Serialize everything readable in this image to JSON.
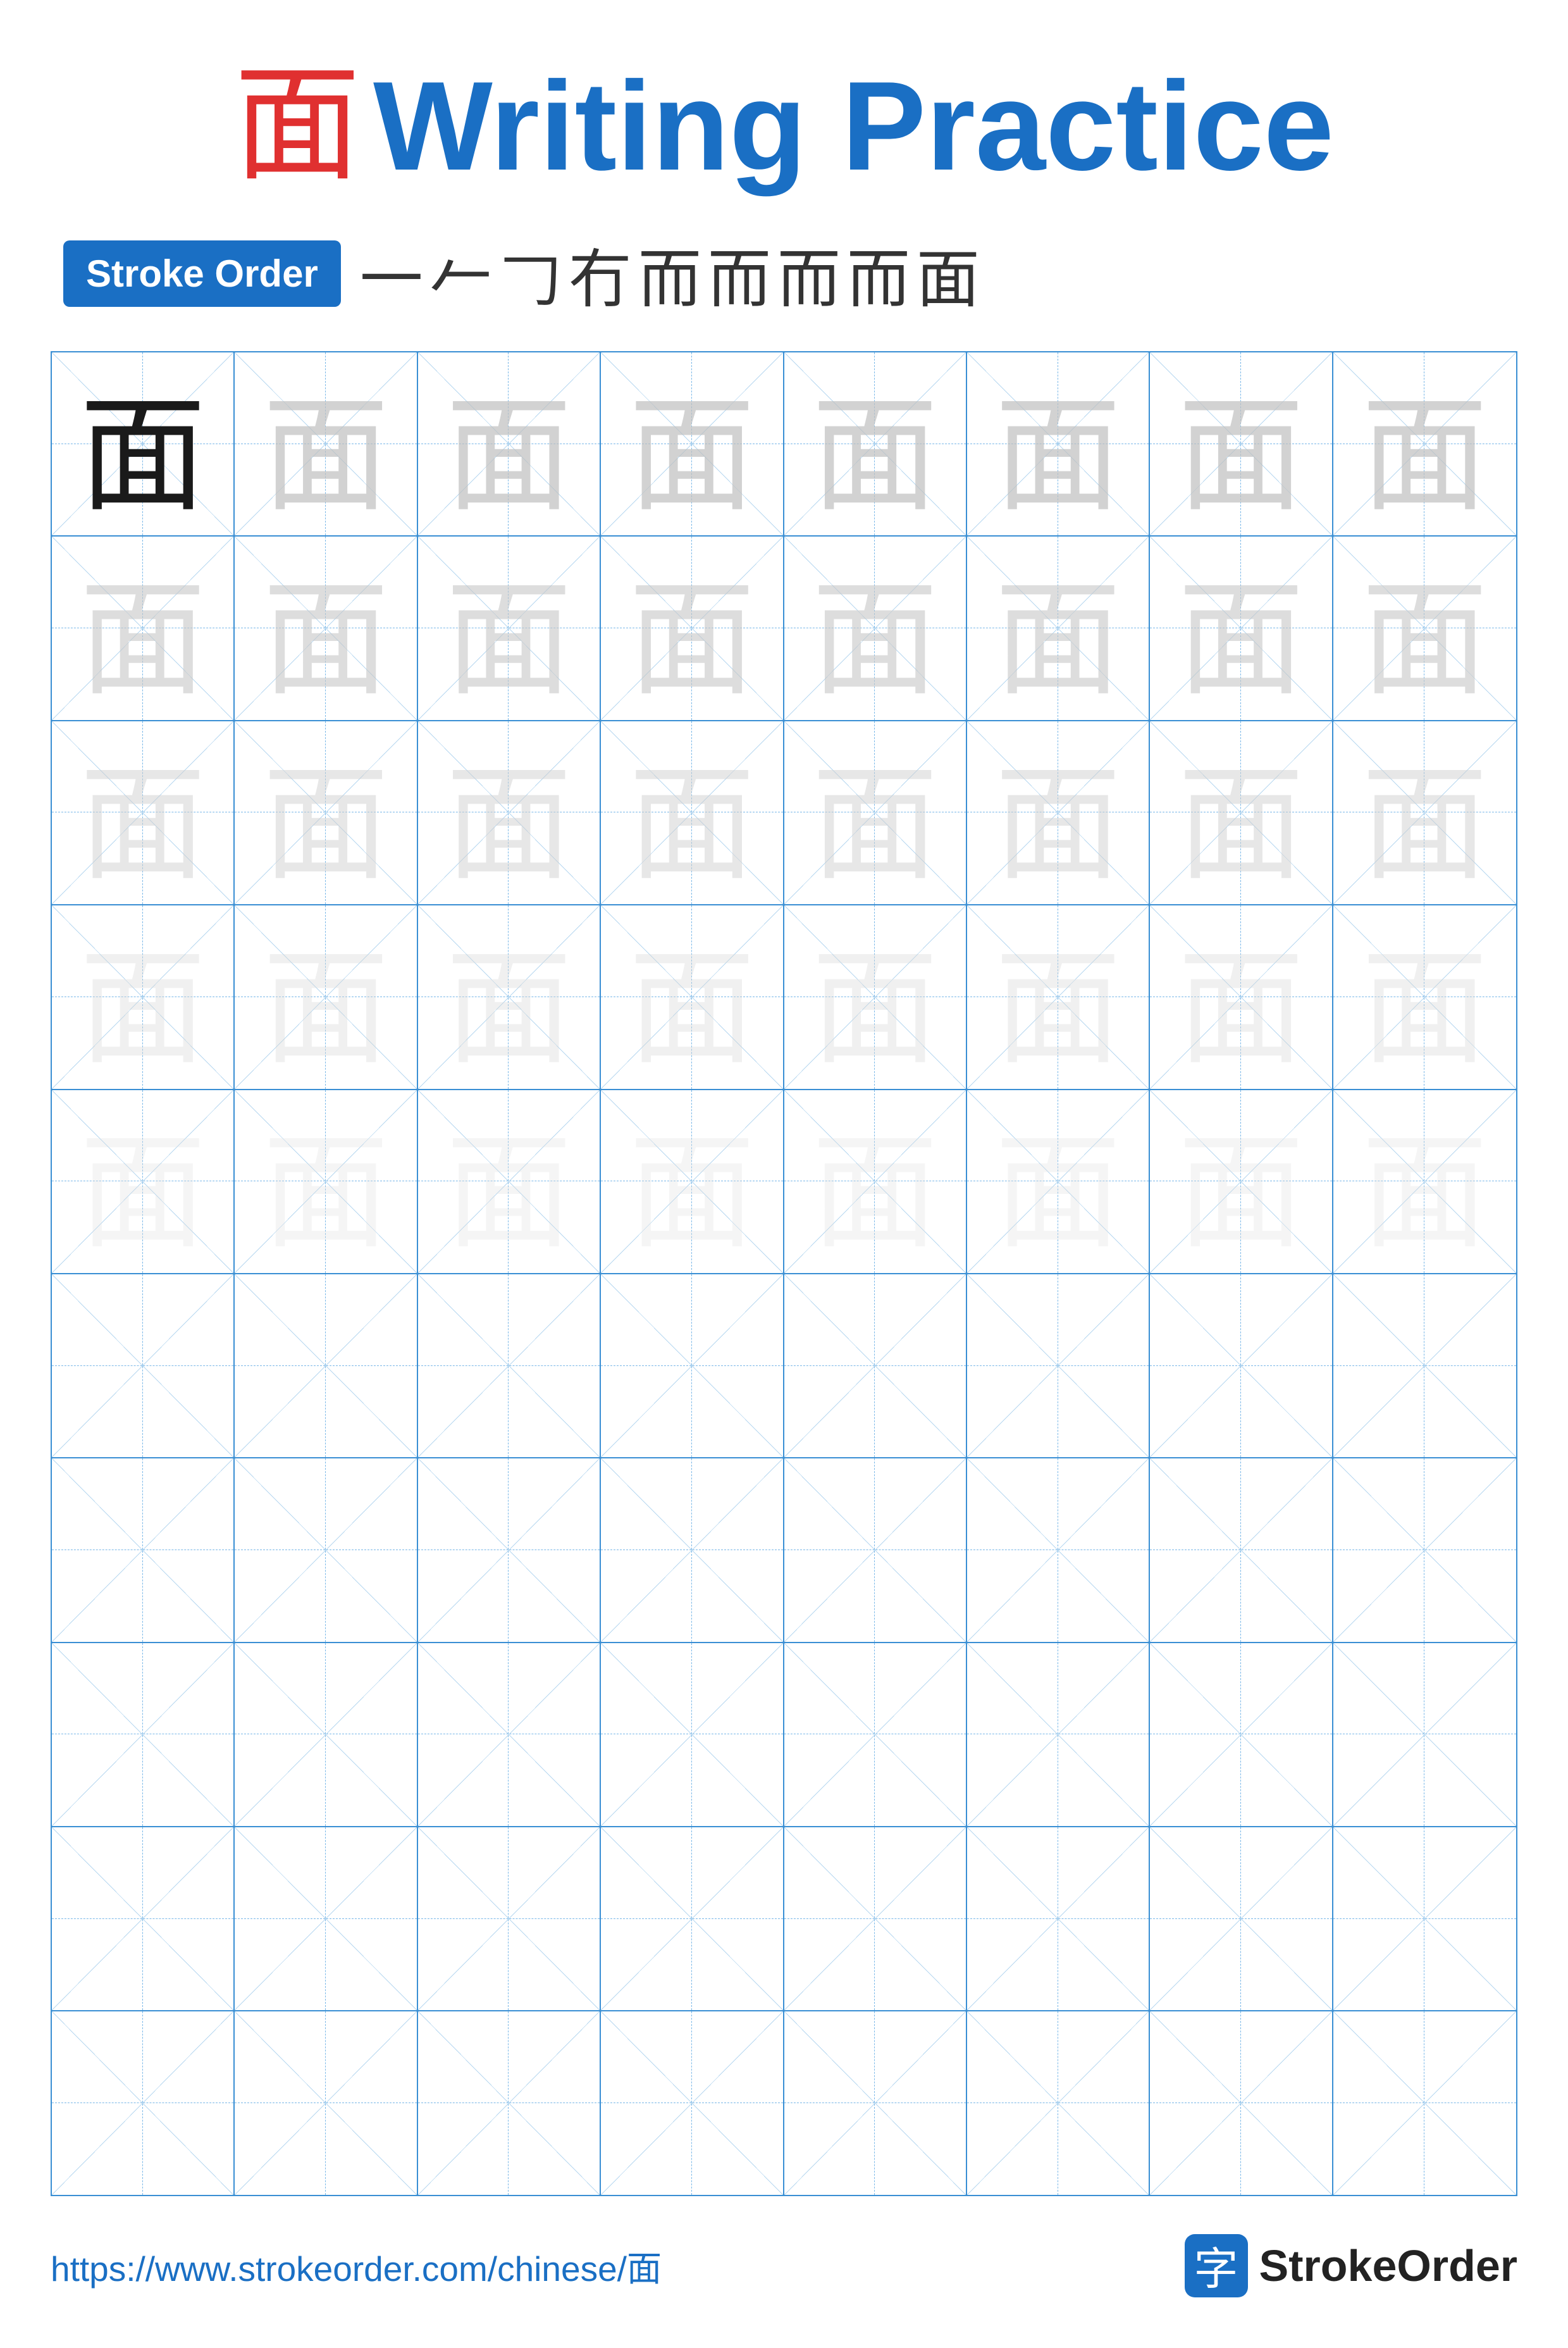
{
  "title": {
    "char": "面",
    "text": "Writing Practice"
  },
  "strokeOrder": {
    "badge": "Stroke Order",
    "strokes": [
      "一",
      "𠂉",
      "𠃌",
      "𠃍",
      "而",
      "而",
      "而",
      "而",
      "面"
    ]
  },
  "grid": {
    "rows": 10,
    "cols": 8,
    "charRows": 5,
    "char": "面"
  },
  "footer": {
    "url": "https://www.strokeorder.com/chinese/面",
    "logoChar": "字",
    "logoText": "StrokeOrder"
  }
}
